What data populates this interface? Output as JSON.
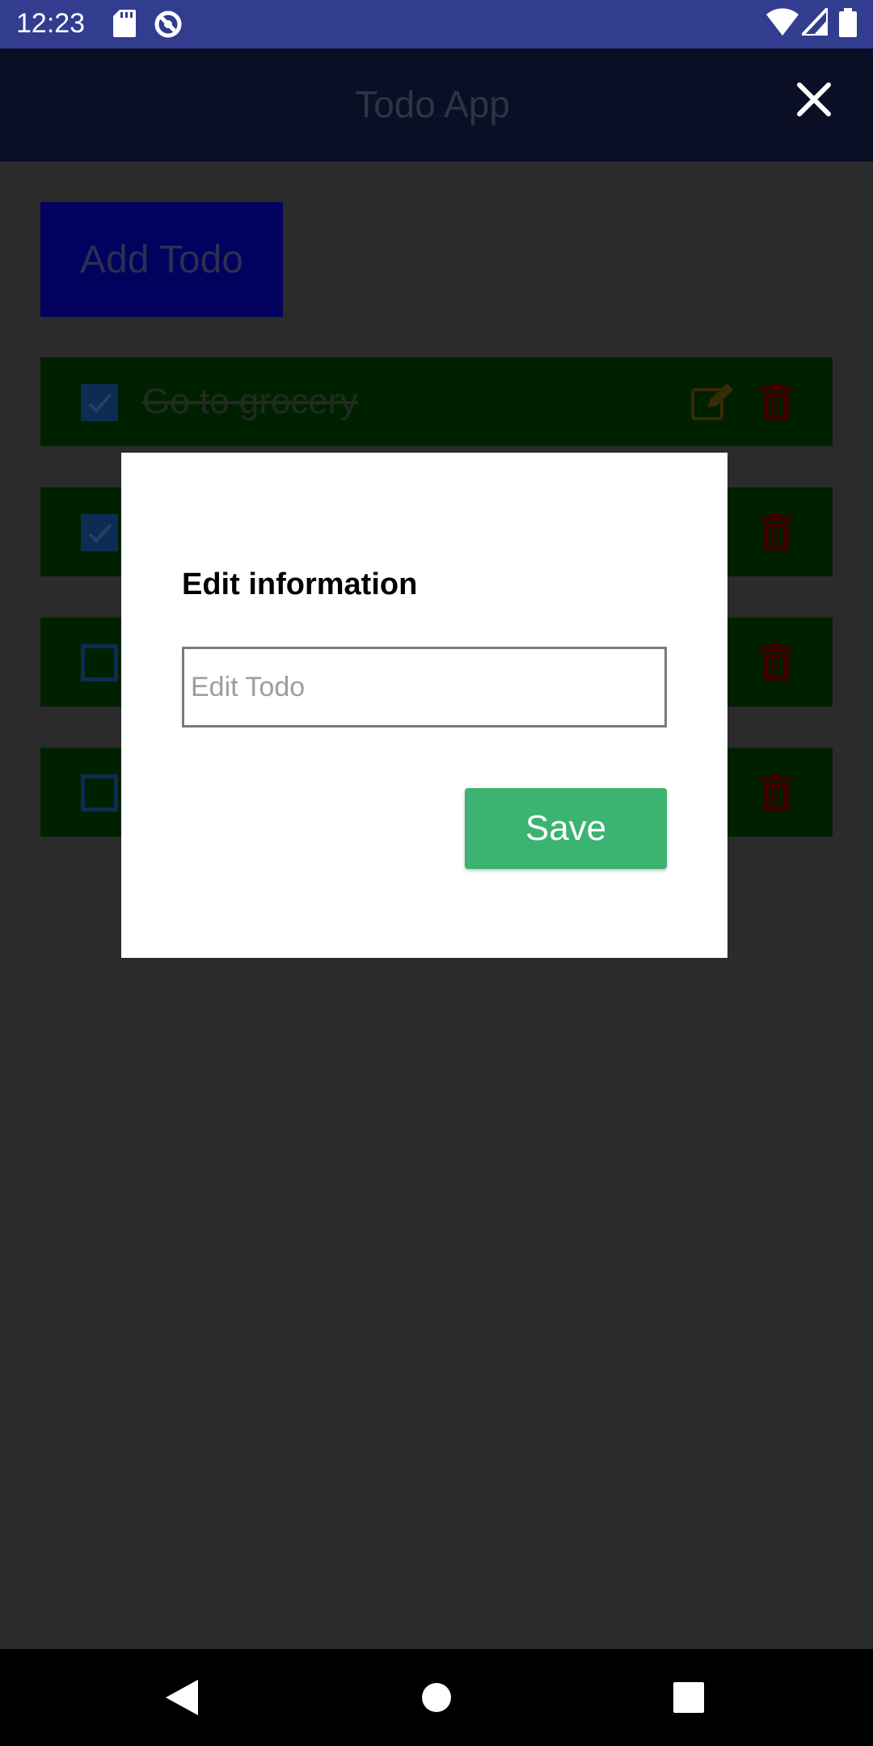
{
  "status_bar": {
    "time": "12:23",
    "left_icons": [
      "sd-card-icon",
      "sync-icon"
    ],
    "right_icons": [
      "wifi-icon",
      "signal-icon",
      "battery-icon"
    ]
  },
  "app_bar": {
    "title": "Todo App",
    "close_icon": "close-icon"
  },
  "content": {
    "add_button_label": "Add Todo",
    "todos": [
      {
        "text": "Go to grocery",
        "done": true
      },
      {
        "text": "",
        "done": true
      },
      {
        "text": "",
        "done": false
      },
      {
        "text": "",
        "done": false
      }
    ]
  },
  "modal": {
    "title": "Edit information",
    "input_placeholder": "Edit Todo",
    "input_value": "",
    "save_label": "Save"
  },
  "colors": {
    "status_bar": "#323d8f",
    "app_bar": "#0b0f25",
    "backdrop": "#2b2b2b",
    "save_button": "#3cb371",
    "todo_row": "#002100",
    "add_button": "#02025e"
  }
}
